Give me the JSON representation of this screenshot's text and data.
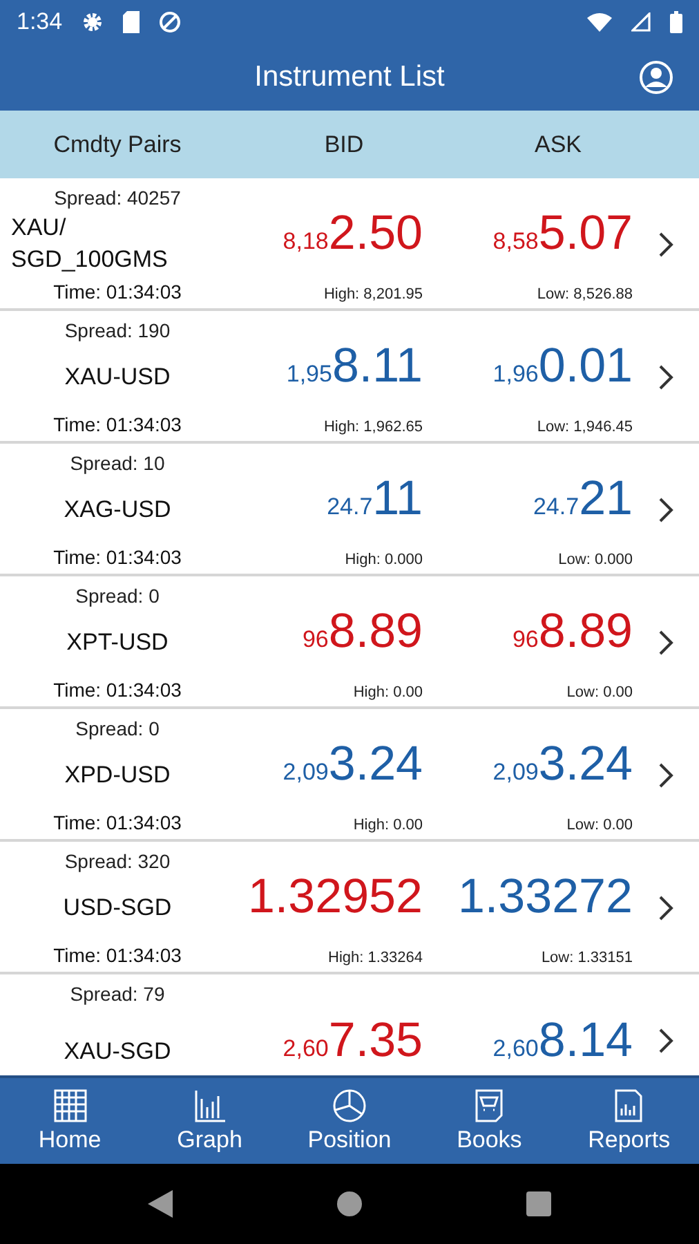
{
  "status_bar": {
    "time": "1:34"
  },
  "app_bar": {
    "title": "Instrument List"
  },
  "columns": [
    "Cmdty Pairs",
    "BID",
    "ASK"
  ],
  "rows": [
    {
      "spread": "Spread: 40257",
      "name": "XAU/\nSGD_100GMS",
      "time": "Time: 01:34:03",
      "bid": {
        "prefix": "8,18",
        "main": "2.50",
        "color": "#d0161c"
      },
      "ask": {
        "prefix": "8,58",
        "main": "5.07",
        "color": "#d0161c"
      },
      "high": "High: 8,201.95",
      "low": "Low: 8,526.88"
    },
    {
      "spread": "Spread: 190",
      "name": "XAU-USD",
      "time": "Time: 01:34:03",
      "bid": {
        "prefix": "1,95",
        "main": "8.11",
        "color": "#1e5fa6"
      },
      "ask": {
        "prefix": "1,96",
        "main": "0.01",
        "color": "#1e5fa6"
      },
      "high": "High: 1,962.65",
      "low": "Low: 1,946.45"
    },
    {
      "spread": "Spread: 10",
      "name": "XAG-USD",
      "time": "Time: 01:34:03",
      "bid": {
        "prefix": "24.7",
        "main": "11",
        "color": "#1e5fa6"
      },
      "ask": {
        "prefix": "24.7",
        "main": "21",
        "color": "#1e5fa6"
      },
      "high": "High: 0.000",
      "low": "Low: 0.000"
    },
    {
      "spread": "Spread: 0",
      "name": "XPT-USD",
      "time": "Time: 01:34:03",
      "bid": {
        "prefix": "96",
        "main": "8.89",
        "color": "#d0161c"
      },
      "ask": {
        "prefix": "96",
        "main": "8.89",
        "color": "#d0161c"
      },
      "high": "High: 0.00",
      "low": "Low: 0.00"
    },
    {
      "spread": "Spread: 0",
      "name": "XPD-USD",
      "time": "Time: 01:34:03",
      "bid": {
        "prefix": "2,09",
        "main": "3.24",
        "color": "#1e5fa6"
      },
      "ask": {
        "prefix": "2,09",
        "main": "3.24",
        "color": "#1e5fa6"
      },
      "high": "High: 0.00",
      "low": "Low: 0.00"
    },
    {
      "spread": "Spread: 320",
      "name": "USD-SGD",
      "time": "Time: 01:34:03",
      "bid": {
        "main": "1.32952",
        "color": "#d0161c"
      },
      "ask": {
        "main": "1.33272",
        "color": "#1e5fa6"
      },
      "high": "High: 1.33264",
      "low": "Low: 1.33151"
    },
    {
      "spread": "Spread: 79",
      "name": "XAU-SGD",
      "bid": {
        "prefix": "2,60",
        "main": "7.35",
        "color": "#d0161c"
      },
      "ask": {
        "prefix": "2,60",
        "main": "8.14",
        "color": "#1e5fa6"
      }
    }
  ],
  "bottom_nav": [
    {
      "label": "Home"
    },
    {
      "label": "Graph"
    },
    {
      "label": "Position"
    },
    {
      "label": "Books"
    },
    {
      "label": "Reports"
    }
  ]
}
